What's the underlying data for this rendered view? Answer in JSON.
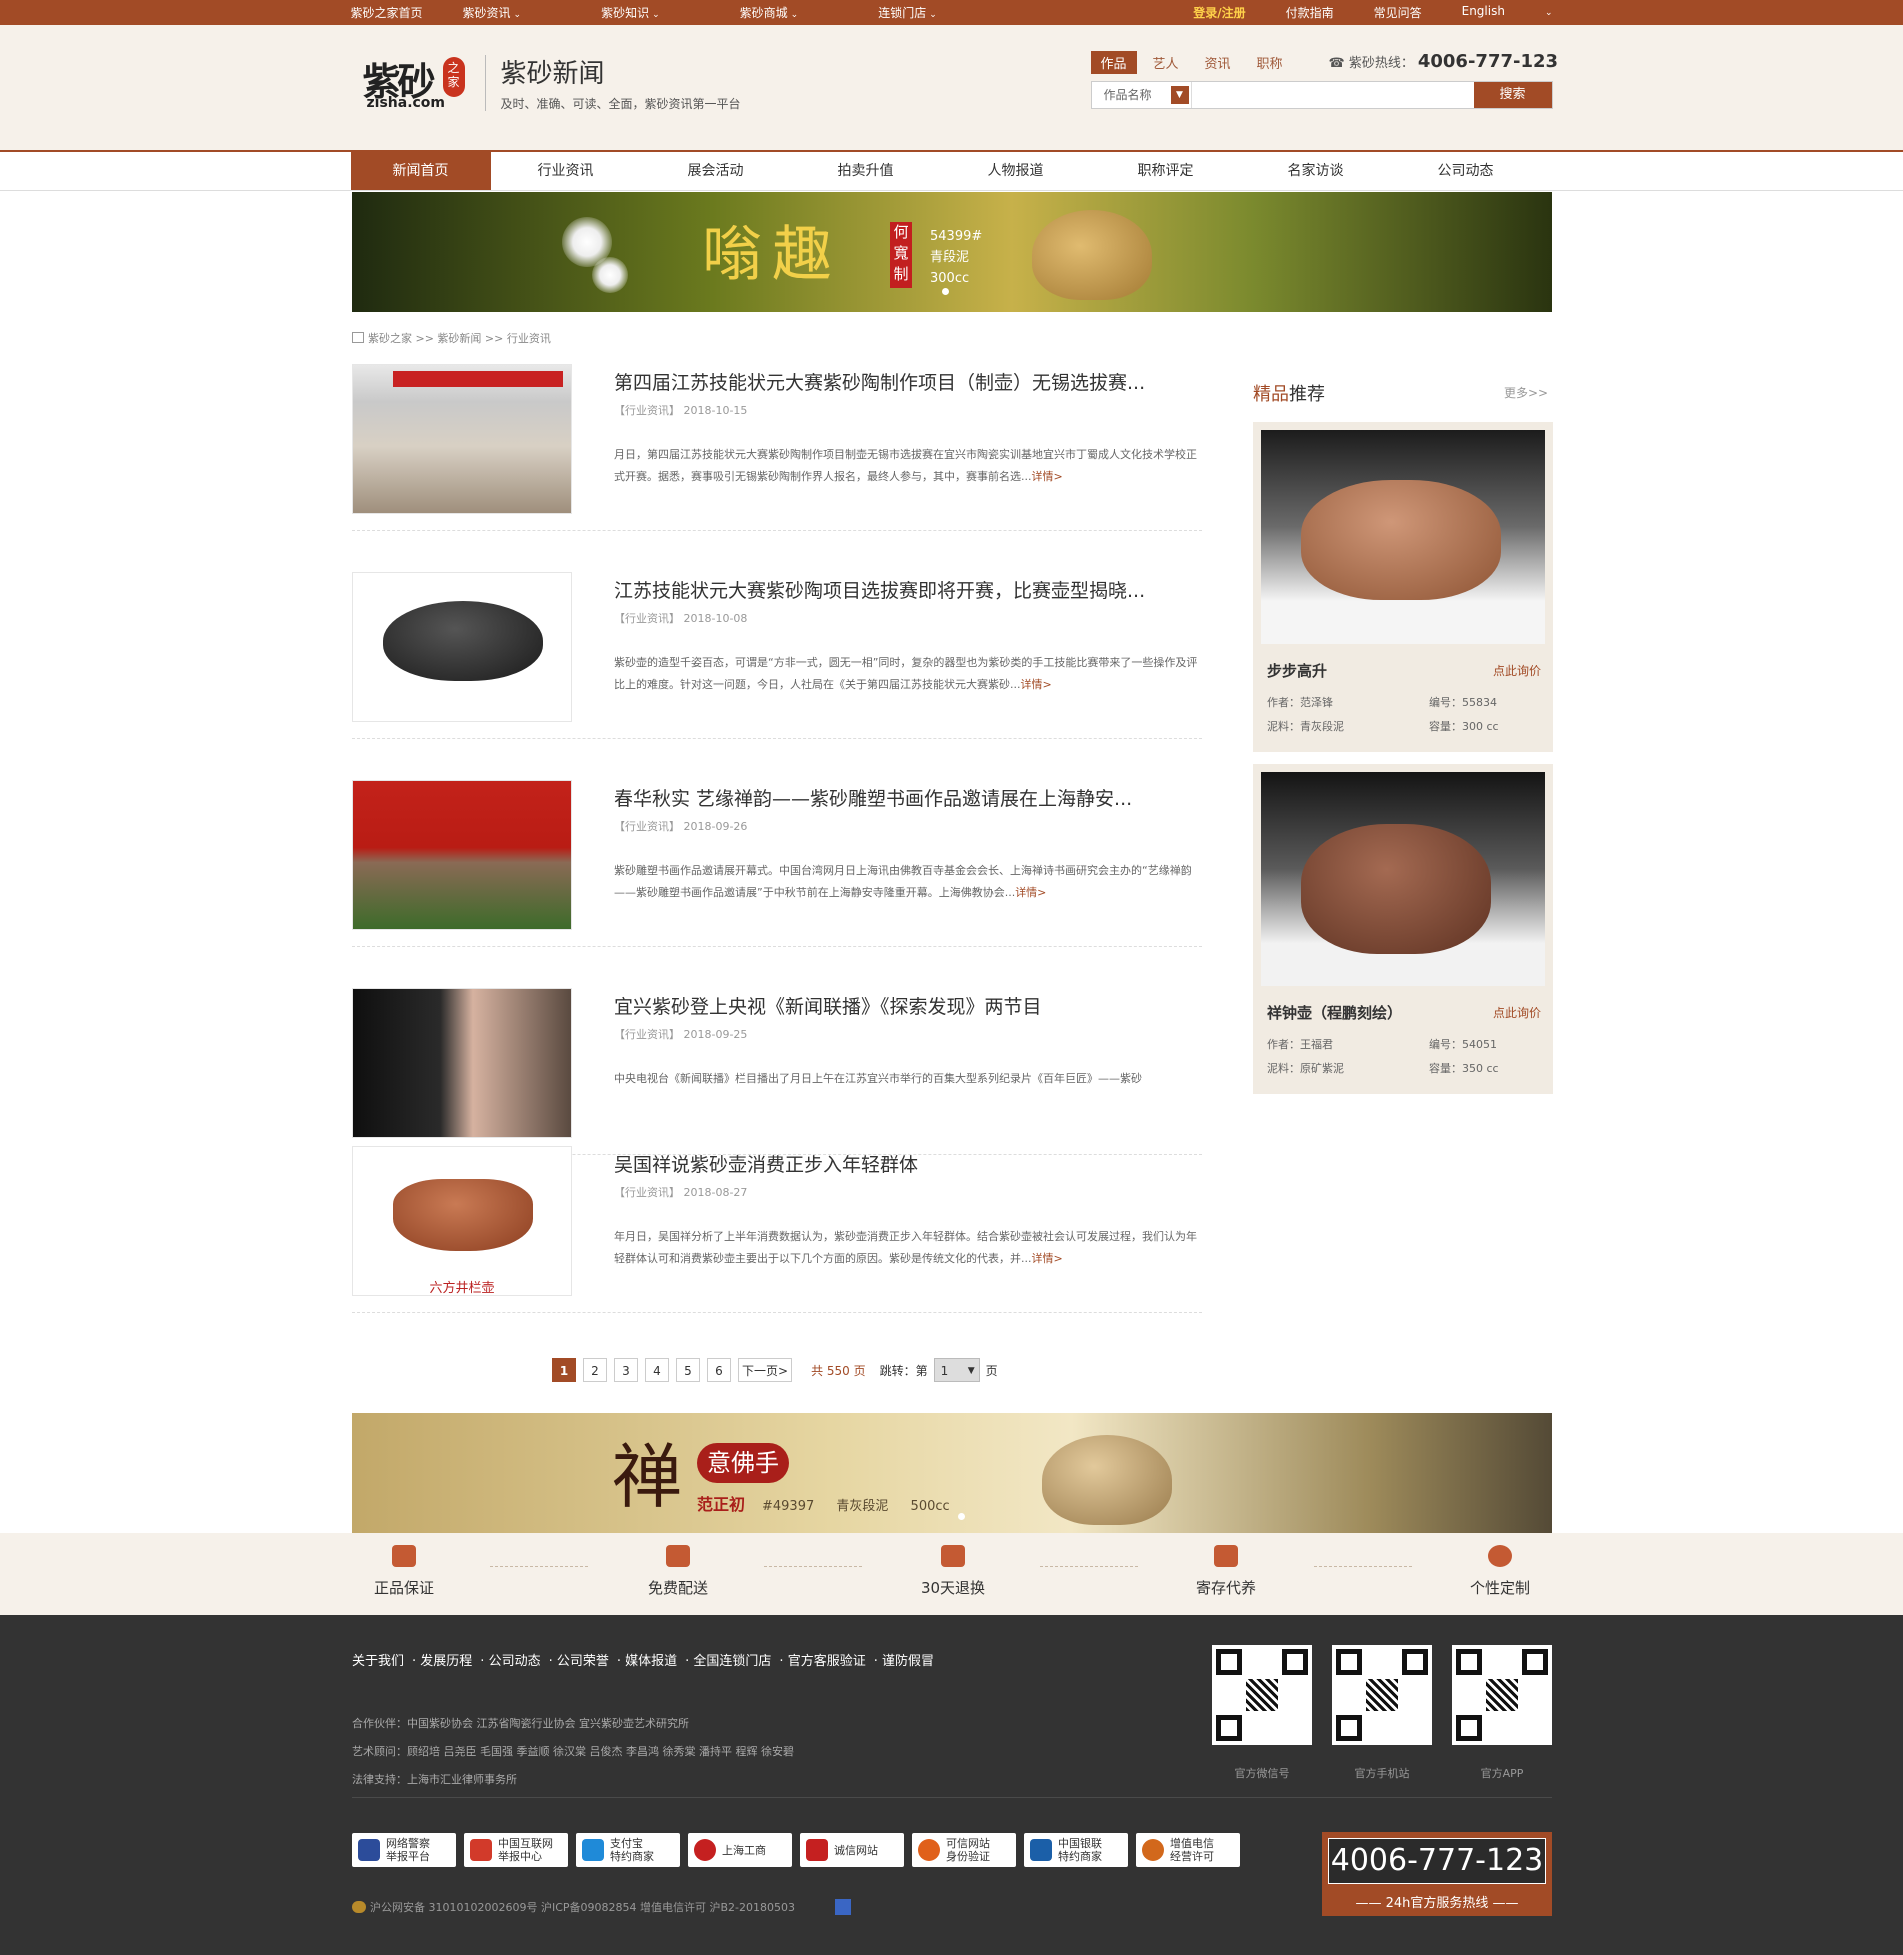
{
  "topbar": {
    "left": [
      "紫砂之家首页",
      "紫砂资讯",
      "紫砂知识",
      "紫砂商城",
      "连锁门店"
    ],
    "login": "登录/注册",
    "right": [
      "付款指南",
      "常见问答",
      "English"
    ]
  },
  "header": {
    "logo_text": "紫砂",
    "logo_seal": "之家",
    "logo_domain": "zisha.com",
    "section_title": "紫砂新闻",
    "section_sub": "及时、准确、可读、全面，紫砂资讯第一平台",
    "search_tabs": [
      "作品",
      "艺人",
      "资讯",
      "职称"
    ],
    "hotline_label": "紫砂热线：",
    "hotline": "4006-777-123",
    "search_category": "作品名称",
    "search_placeholder": "",
    "search_button": "搜索"
  },
  "nav": [
    "新闻首页",
    "行业资讯",
    "展会活动",
    "拍卖升值",
    "人物报道",
    "职称评定",
    "名家访谈",
    "公司动态"
  ],
  "banner": {
    "headline": "嗡趣",
    "stamp": "何寬制",
    "code": "54399#",
    "clay": "青段泥",
    "volume": "300cc"
  },
  "breadcrumb": "紫砂之家 >> 紫砂新闻 >> 行业资讯",
  "articles": [
    {
      "title": "第四届江苏技能状元大赛紫砂陶制作项目（制壶）无锡选拔赛...",
      "category": "【行业资讯】",
      "date": "2018-10-15",
      "desc": "月日，第四届江苏技能状元大赛紫砂陶制作项目制壶无锡市选拔赛在宜兴市陶瓷实训基地宜兴市丁蜀成人文化技术学校正式开赛。据悉，赛事吸引无锡紫砂陶制作界人报名，最终人参与，其中，赛事前名选...",
      "more": "详情>"
    },
    {
      "title": "江苏技能状元大赛紫砂陶项目选拔赛即将开赛，比赛壶型揭晓...",
      "category": "【行业资讯】",
      "date": "2018-10-08",
      "desc": "紫砂壶的造型千姿百态，可谓是“方非一式，圆无一相”同时，复杂的器型也为紫砂类的手工技能比赛带来了一些操作及评比上的难度。针对这一问题，今日，人社局在《关于第四届江苏技能状元大赛紫砂...",
      "more": "详情>"
    },
    {
      "title": "春华秋实 艺缘禅韵——紫砂雕塑书画作品邀请展在上海静安...",
      "category": "【行业资讯】",
      "date": "2018-09-26",
      "desc": "紫砂雕塑书画作品邀请展开幕式。中国台湾网月日上海讯由佛教百寺基金会会长、上海禅诗书画研究会主办的“艺缘禅韵——紫砂雕塑书画作品邀请展”于中秋节前在上海静安寺隆重开幕。上海佛教协会...",
      "more": "详情>"
    },
    {
      "title": "宜兴紫砂登上央视《新闻联播》《探索发现》两节目",
      "category": "【行业资讯】",
      "date": "2018-09-25",
      "desc": "中央电视台《新闻联播》栏目播出了月日上午在江苏宜兴市举行的百集大型系列纪录片《百年巨匠》——紫砂",
      "more": ""
    },
    {
      "title": "吴国祥说紫砂壶消费正步入年轻群体",
      "category": "【行业资讯】",
      "date": "2018-08-27",
      "desc": "年月日，吴国祥分析了上半年消费数据认为，紫砂壶消费正步入年轻群体。结合紫砂壶被社会认可发展过程，我们认为年轻群体认可和消费紫砂壶主要出于以下几个方面的原因。紫砂是传统文化的代表，并...",
      "more": "详情>",
      "img_caption": "六方井栏壶"
    }
  ],
  "recommend": {
    "title_hl": "精品",
    "title_rest": "推荐",
    "more": "更多>>",
    "items": [
      {
        "name": "步步高升",
        "ask": "点此询价",
        "author": "作者：范泽锋",
        "code": "编号：55834",
        "clay": "泥料：青灰段泥",
        "volume": "容量：300 cc"
      },
      {
        "name": "祥钟壶（程鹏刻绘）",
        "ask": "点此询价",
        "author": "作者：王福君",
        "code": "编号：54051",
        "clay": "泥料：原矿紫泥",
        "volume": "容量：350 cc"
      }
    ]
  },
  "pager": {
    "pages": [
      "1",
      "2",
      "3",
      "4",
      "5",
      "6"
    ],
    "next": "下一页>",
    "total": "共 550 页",
    "jump": "跳转：第",
    "selected": "1",
    "unit": "页"
  },
  "banner2": {
    "zen": "禅",
    "title": "意佛手",
    "maker": "范正初",
    "code": "#49397",
    "clay": "青灰段泥",
    "volume": "500cc"
  },
  "services": [
    "正品保证",
    "免费配送",
    "30天退换",
    "寄存代养",
    "个性定制"
  ],
  "footer": {
    "links": [
      "关于我们",
      "发展历程",
      "公司动态",
      "公司荣誉",
      "媒体报道",
      "全国连锁门店",
      "官方客服验证",
      "谨防假冒"
    ],
    "partners": "合作伙伴：中国紫砂协会 江苏省陶瓷行业协会 宜兴紫砂壶艺术研究所",
    "advisors": "艺术顾问：顾绍培 吕尧臣 毛国强 季益顺 徐汉棠 吕俊杰 李昌鸿 徐秀棠 潘持平 程辉 徐安碧",
    "legal": "法律支持：上海市汇业律师事务所",
    "qr": [
      "官方微信号",
      "官方手机站",
      "官方APP"
    ],
    "trust": [
      {
        "label": "网络警察\n举报平台",
        "color": "#2c4c9a"
      },
      {
        "label": "中国互联网\n举报中心",
        "color": "#d23a2a"
      },
      {
        "label": "支付宝\n特约商家",
        "color": "#1f8ad8"
      },
      {
        "label": "上海工商",
        "color": "#c52020"
      },
      {
        "label": "诚信网站",
        "color": "#c52020"
      },
      {
        "label": "可信网站\n身份验证",
        "color": "#e0601a"
      },
      {
        "label": "中国银联\n特约商家",
        "color": "#1b5fa8"
      },
      {
        "label": "增值电信\n经营许可",
        "color": "#d2681c"
      }
    ],
    "icp": "沪公网安备 31010102002609号 沪ICP备09082854 增值电信许可 沪B2-20180503",
    "hotline": "4006-777-123",
    "hotline_caption": "—— 24h官方服务热线 ——"
  }
}
